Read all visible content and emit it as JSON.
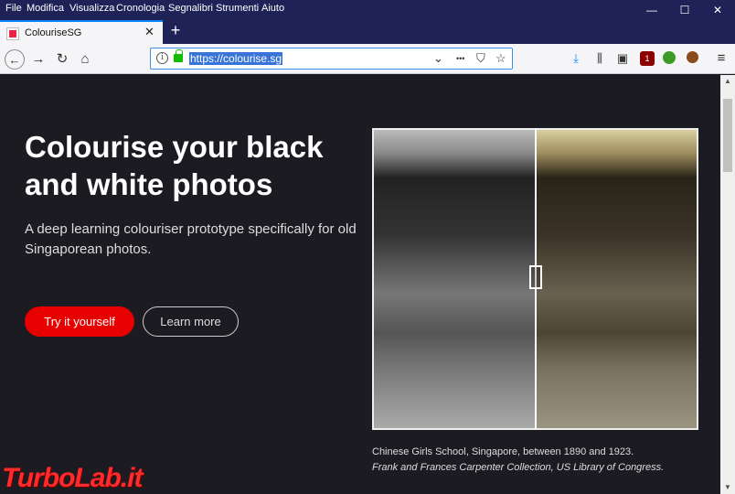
{
  "menu": [
    "File",
    "Modifica",
    "Visualizza",
    "Cronologia",
    "Segnalibri",
    "Strumenti",
    "Aiuto"
  ],
  "window_controls": {
    "minimize": "—",
    "maximize": "☐",
    "close": "✕"
  },
  "tab": {
    "title": "ColouriseSG",
    "close": "✕"
  },
  "newtab": "+",
  "nav": {
    "back": "←",
    "forward": "→",
    "reload": "↻",
    "home": "⌂"
  },
  "urlbar": {
    "url": "https://colourise.sg",
    "info": "i",
    "dropdown": "⌄",
    "more": "•••",
    "pocket": "⛉",
    "bookmark": "☆"
  },
  "toolbar_icons": {
    "download": "⤓",
    "library": "⫼",
    "sidebar": "▣",
    "ublock_badge": "1",
    "menu": "≡"
  },
  "hero": {
    "headline": "Colourise your black and white photos",
    "subtitle": "A deep learning colouriser prototype specifically for old Singaporean photos.",
    "try_button": "Try it yourself",
    "learn_button": "Learn more"
  },
  "photo": {
    "caption": "Chinese Girls School, Singapore, between 1890 and 1923.",
    "credit": "Frank and Frances Carpenter Collection, US Library of Congress."
  },
  "watermark": "TurboLab.it",
  "scrollbar": {
    "up": "▲",
    "down": "▼"
  }
}
